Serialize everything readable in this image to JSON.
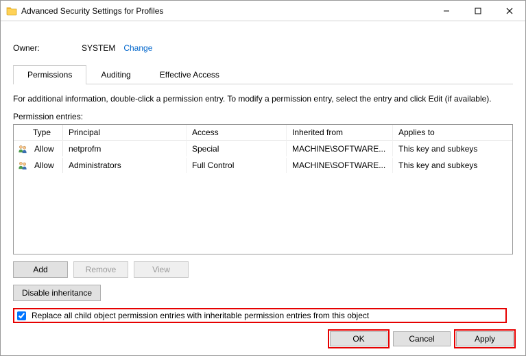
{
  "title": "Advanced Security Settings for Profiles",
  "owner": {
    "label": "Owner:",
    "value": "SYSTEM",
    "change": "Change"
  },
  "tabs": {
    "permissions": "Permissions",
    "auditing": "Auditing",
    "effective": "Effective Access"
  },
  "info_text": "For additional information, double-click a permission entry. To modify a permission entry, select the entry and click Edit (if available).",
  "entries_label": "Permission entries:",
  "columns": {
    "type": "Type",
    "principal": "Principal",
    "access": "Access",
    "inherited": "Inherited from",
    "applies": "Applies to"
  },
  "rows": [
    {
      "type": "Allow",
      "principal": "netprofm",
      "access": "Special",
      "inherited": "MACHINE\\SOFTWARE...",
      "applies": "This key and subkeys"
    },
    {
      "type": "Allow",
      "principal": "Administrators",
      "access": "Full Control",
      "inherited": "MACHINE\\SOFTWARE...",
      "applies": "This key and subkeys"
    }
  ],
  "buttons": {
    "add": "Add",
    "remove": "Remove",
    "view": "View",
    "disable_inheritance": "Disable inheritance",
    "ok": "OK",
    "cancel": "Cancel",
    "apply": "Apply"
  },
  "replace_label": "Replace all child object permission entries with inheritable permission entries from this object"
}
